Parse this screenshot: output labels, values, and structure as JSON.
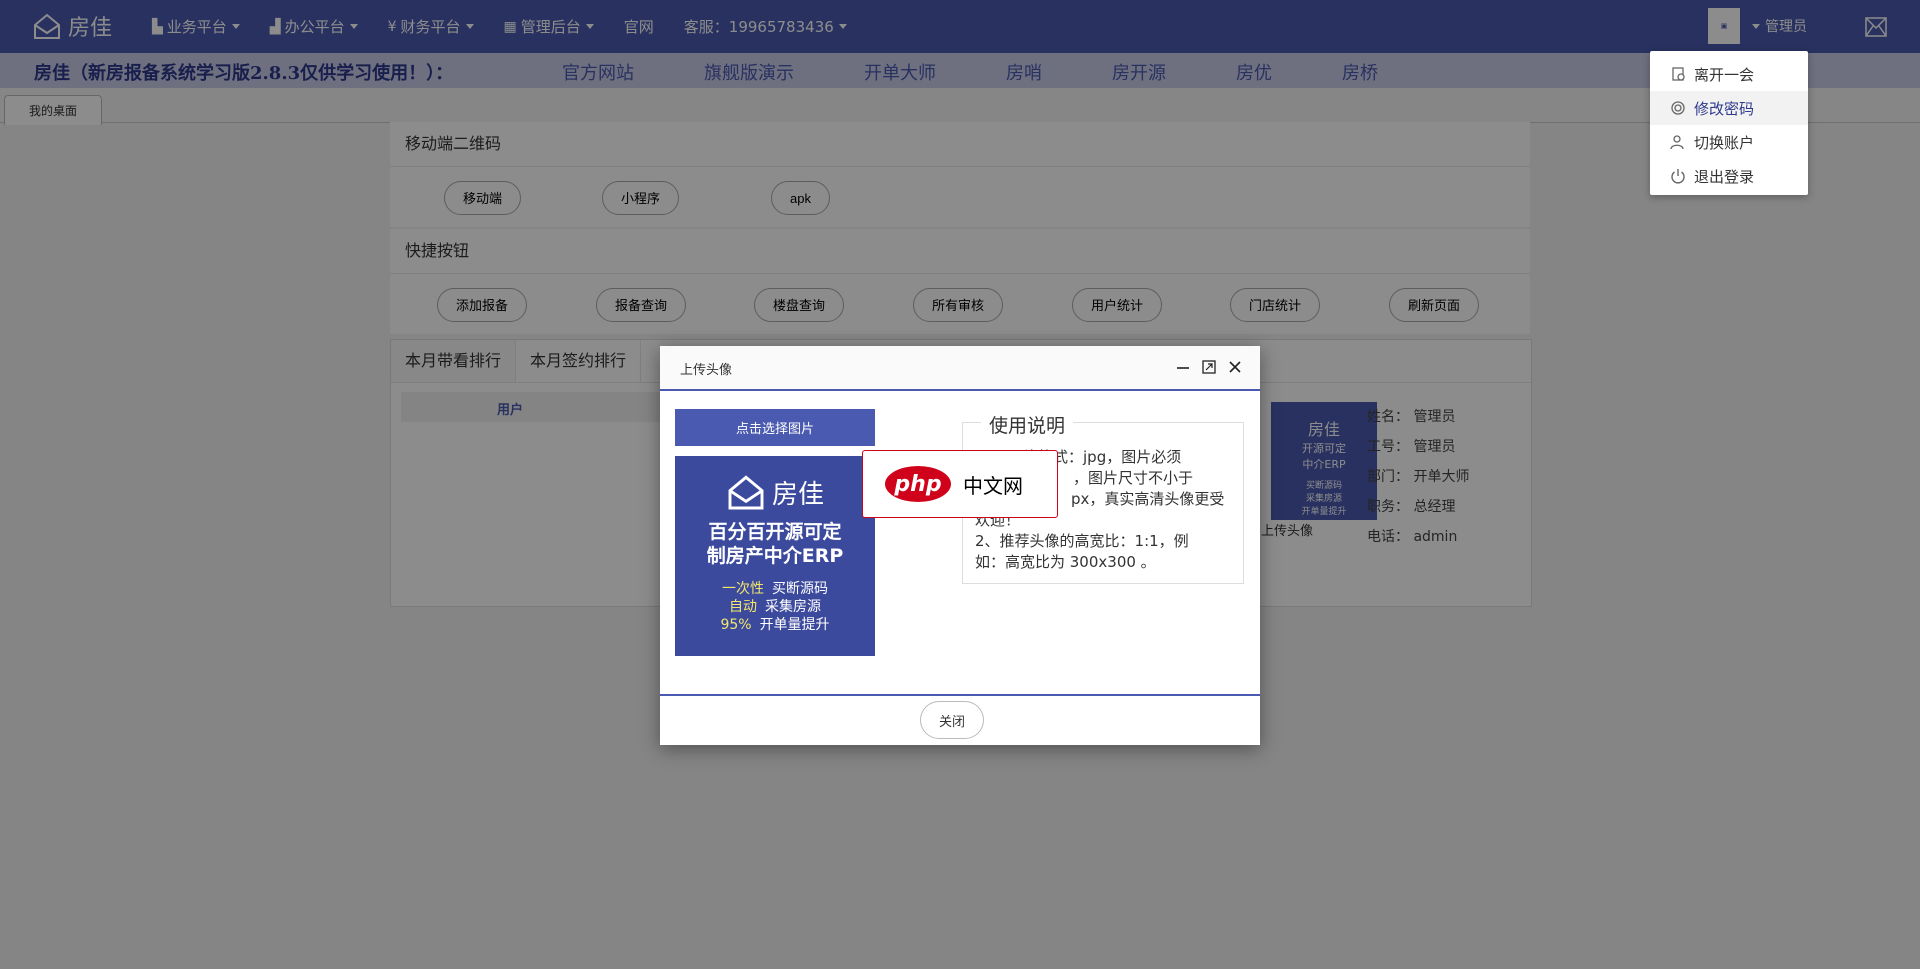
{
  "app": {
    "brand": "房佳",
    "accent": "#4a5ab0"
  },
  "nav": [
    {
      "icon": "building-icon",
      "label": "业务平台",
      "dropdown": true
    },
    {
      "icon": "office-icon",
      "label": "办公平台",
      "dropdown": true
    },
    {
      "icon": "finance-icon",
      "label": "财务平台",
      "dropdown": true
    },
    {
      "icon": "grid-icon",
      "label": "管理后台",
      "dropdown": true
    },
    {
      "label": "官网",
      "dropdown": false
    },
    {
      "label": "客服：19965783436",
      "dropdown": true
    }
  ],
  "user": {
    "name": "管理员"
  },
  "announce": {
    "title": "房佳（新房报备系统学习版2.8.3仅供学习使用！）：",
    "links": [
      "官方网站",
      "旗舰版演示",
      "开单大师",
      "房哨",
      "房开源",
      "房优",
      "房桥"
    ]
  },
  "tabs": [
    {
      "label": "我的桌面"
    }
  ],
  "mobile_panel": {
    "title": "移动端二维码",
    "buttons": [
      "移动端",
      "小程序",
      "apk"
    ]
  },
  "quick_panel": {
    "title": "快捷按钮",
    "buttons": [
      "添加报备",
      "报备查询",
      "楼盘查询",
      "所有审核",
      "用户统计",
      "门店统计",
      "刷新页面"
    ]
  },
  "stats": {
    "tabs": [
      "本月带看排行",
      "本月签约排行"
    ],
    "table_header": "用户",
    "profile_caption": "上传头像",
    "profile_thumb_lines": [
      "房佳",
      "开源可定",
      "中介ERP",
      "买断源码",
      "采集房源",
      "开单量提升"
    ],
    "profile": [
      {
        "label": "姓名：",
        "value": "管理员"
      },
      {
        "label": "工号：",
        "value": "管理员"
      },
      {
        "label": "部门：",
        "value": "开单大师"
      },
      {
        "label": "职务：",
        "value": "总经理"
      },
      {
        "label": "电话：",
        "value": "admin"
      }
    ]
  },
  "dropdown": {
    "items": [
      {
        "icon": "leave-icon",
        "label": "离开一会",
        "active": false
      },
      {
        "icon": "key-icon",
        "label": "修改密码",
        "active": true
      },
      {
        "icon": "switch-user-icon",
        "label": "切换账户",
        "active": false
      },
      {
        "icon": "power-icon",
        "label": "退出登录",
        "active": false
      }
    ]
  },
  "modal": {
    "title": "上传头像",
    "select_button": "点击选择图片",
    "preview": {
      "brand": "房佳",
      "line1": "百分百开源可定",
      "line2": "制房产中介ERP",
      "perks": [
        {
          "k": "一次性",
          "v": "买断源码"
        },
        {
          "k": "自动",
          "v": "采集房源"
        },
        {
          "k": "95%",
          "v": "开单量提升"
        }
      ]
    },
    "legend": "使用说明",
    "instructions": [
      "片格式：jpg，图片必须",
      "，图片尺寸不小于",
      "px，真实高清头像更受",
      "欢迎！",
      "2、推荐头像的高宽比：1:1，例",
      "如：高宽比为 300x300 。"
    ],
    "close_button": "关闭"
  },
  "watermark": {
    "logo": "php",
    "text": "中文网",
    "color": "#d0021b"
  }
}
